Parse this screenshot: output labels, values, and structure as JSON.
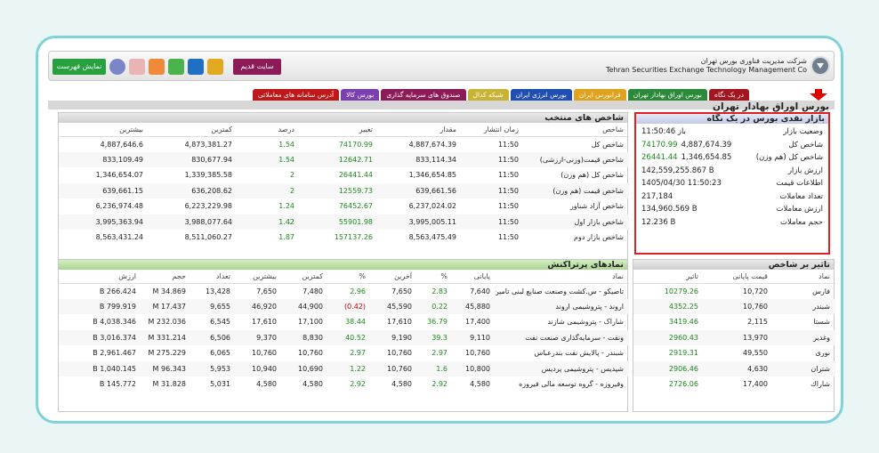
{
  "topbar": {
    "company_fa": "شرکت مدیریت فناوری بورس تهران",
    "company_en": "Tehran Securities Exchange Technology Management Co",
    "menu_button": "نمایش فهرست",
    "old_site_button": "سایت قدیم"
  },
  "tabs": [
    {
      "label": "در یک نگاه",
      "color": "#a3161f"
    },
    {
      "label": "بورس اوراق بهادار تهران",
      "color": "#2b8a3a"
    },
    {
      "label": "فرابورس ایران",
      "color": "#e0a21c"
    },
    {
      "label": "بورس انرژی ایران",
      "color": "#1f4fb3"
    },
    {
      "label": "شبکه کدال",
      "color": "#c9b334"
    },
    {
      "label": "صندوق های سرمایه گذاری",
      "color": "#8c1b58"
    },
    {
      "label": "بورس کالا",
      "color": "#7b3fb2"
    },
    {
      "label": "آدرس سامانه های معاملاتی",
      "color": "#c01818"
    }
  ],
  "page_title": "بورس اوراق بهادار تهران",
  "indices": {
    "title": "شاخص های منتخب",
    "columns": [
      "شاخص",
      "زمان انتشار",
      "مقدار",
      "تغییر",
      "درصد",
      "کمترین",
      "بیشترین"
    ],
    "rows": [
      [
        "شاخص کل",
        "11:50",
        "4,887,674.39",
        "74170.99",
        "1.54",
        "4,873,381.27",
        "4,887,646.6"
      ],
      [
        "شاخص قیمت(وزنی-ارزشی)",
        "11:50",
        "833,114.34",
        "12642.71",
        "1.54",
        "830,677.94",
        "833,109.49"
      ],
      [
        "شاخص کل (هم وزن)",
        "11:50",
        "1,346,654.85",
        "26441.44",
        "2",
        "1,339,385.58",
        "1,346,654.07"
      ],
      [
        "شاخص قیمت (هم وزن)",
        "11:50",
        "639,661.56",
        "12559.73",
        "2",
        "636,208.62",
        "639,661.15"
      ],
      [
        "شاخص آزاد شناور",
        "11:50",
        "6,237,024.02",
        "76452.67",
        "1.24",
        "6,223,229.98",
        "6,236,974.48"
      ],
      [
        "شاخص بازار اول",
        "11:50",
        "3,995,005.11",
        "55901.98",
        "1.42",
        "3,988,077.64",
        "3,995,363.94"
      ],
      [
        "شاخص بازار دوم",
        "11:50",
        "8,563,475.49",
        "157137.26",
        "1.87",
        "8,511,060.27",
        "8,563,431.24"
      ]
    ]
  },
  "market": {
    "title": "بازار نقدی بورس در یک نگاه",
    "rows": [
      {
        "label": "وضعیت بازار",
        "value": "باز 11:50:46",
        "extra": ""
      },
      {
        "label": "شاخص کل",
        "value": "4,887,674.39",
        "extra": "74170.99"
      },
      {
        "label": "شاخص کل (هم وزن)",
        "value": "1,346,654.85",
        "extra": "26441.44"
      },
      {
        "label": "ارزش بازار",
        "value": "142,559,255.867 B",
        "extra": ""
      },
      {
        "label": "اطلاعات قیمت",
        "value": "1405/04/30 11:50:23",
        "extra": ""
      },
      {
        "label": "تعداد معاملات",
        "value": "217,184",
        "extra": ""
      },
      {
        "label": "ارزش معاملات",
        "value": "134,960.569 B",
        "extra": ""
      },
      {
        "label": "حجم معاملات",
        "value": "12.236 B",
        "extra": ""
      }
    ]
  },
  "active": {
    "title": "نمادهای پرتراکنش",
    "columns": [
      "نماد",
      "پایانی",
      "%",
      "آخرین",
      "%",
      "کمترین",
      "بیشترین",
      "تعداد",
      "حجم",
      "ارزش"
    ],
    "rows": [
      [
        "تاصیکو - س.کشت وصنعت صنایع لبنی تامین",
        "7,640",
        "2.83",
        "7,650",
        "2.96",
        "7,480",
        "7,650",
        "13,428",
        "34.869 M",
        "266.424 B"
      ],
      [
        "اروند - پتروشیمی اروند",
        "45,880",
        "0.22",
        "45,590",
        "(0.42)",
        "44,900",
        "46,920",
        "9,655",
        "17.437 M",
        "799.919 B"
      ],
      [
        "شاراک - پتروشیمی شازند",
        "17,400",
        "36.79",
        "17,610",
        "38.44",
        "17,100",
        "17,610",
        "6,545",
        "232.036 M",
        "4,038.346 B"
      ],
      [
        "ونفت - سرمایه‌گذاری صنعت نفت",
        "9,110",
        "39.3",
        "9,190",
        "40.52",
        "8,830",
        "9,370",
        "6,506",
        "331.214 M",
        "3,016.374 B"
      ],
      [
        "شبندر - پالایش نفت بندرعباس",
        "10,760",
        "2.97",
        "10,760",
        "2.97",
        "10,760",
        "10,760",
        "6,065",
        "275.229 M",
        "2,961.467 B"
      ],
      [
        "شپدیس - پتروشیمی پردیس",
        "10,800",
        "1.6",
        "10,760",
        "1.22",
        "10,690",
        "10,940",
        "5,953",
        "96.343 M",
        "1,040.145 B"
      ],
      [
        "وفیروزه - گروه توسعه مالی فیروزه",
        "4,580",
        "2.92",
        "4,580",
        "2.92",
        "4,580",
        "4,580",
        "5,031",
        "31.828 M",
        "145.772 B"
      ]
    ]
  },
  "effect": {
    "title": "تاثیر بر شاخص",
    "columns": [
      "نماد",
      "قیمت پایانی",
      "تاثیر"
    ],
    "rows": [
      [
        "فارس",
        "10,720",
        "10279.26"
      ],
      [
        "شبندر",
        "10,760",
        "4352.25"
      ],
      [
        "شستا",
        "2,115",
        "3419.46"
      ],
      [
        "وغدیر",
        "13,970",
        "2960.43"
      ],
      [
        "نوری",
        "49,550",
        "2919.31"
      ],
      [
        "شتران",
        "4,630",
        "2906.46"
      ],
      [
        "شاراك",
        "17,400",
        "2726.06"
      ]
    ]
  }
}
